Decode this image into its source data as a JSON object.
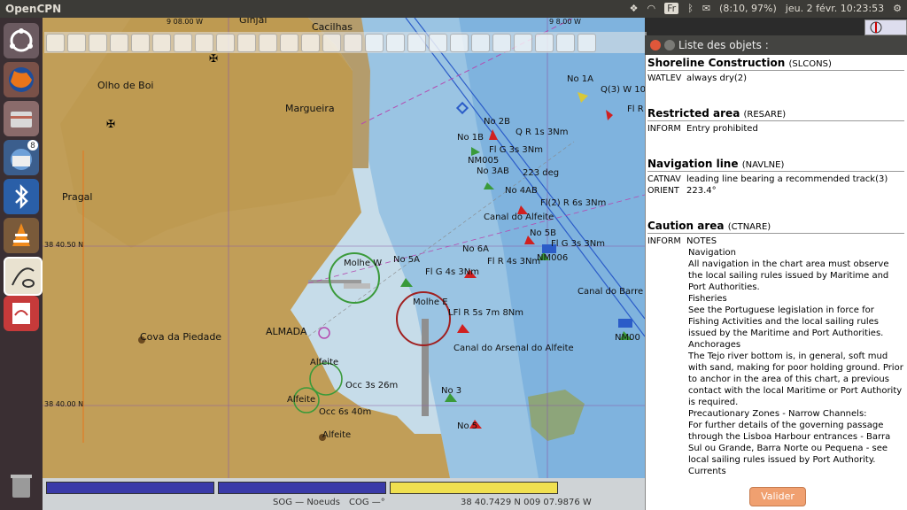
{
  "topbar": {
    "app_name": "OpenCPN",
    "keyboard": "Fr",
    "battery": "(8:10, 97%)",
    "clock": "jeu. 2 févr. 10:23:53"
  },
  "launcher": {
    "items": [
      "ubuntu-icon",
      "firefox-icon",
      "files-icon",
      "thunderbird-icon",
      "bluetooth-icon",
      "vlc-icon",
      "opencpn-icon",
      "evince-icon",
      "trash-icon"
    ],
    "thunderbird_badge": "8"
  },
  "chart": {
    "labels": {
      "ginjal": "Ginjal",
      "cacilhas": "Cacilhas",
      "olho_de_boi": "Olho de Boi",
      "margueira": "Margueira",
      "pragal": "Pragal",
      "cova_da_piedade": "Cova da Piedade",
      "almada": "ALMADA",
      "alfeite1": "Alfeite",
      "alfeite2": "Alfeite",
      "alfeite3": "Alfeite",
      "molhe_w": "Molhe W",
      "molhe_e": "Molhe E",
      "no1a": "No 1A",
      "q3": "Q(3) W 10",
      "no2b": "No 2B",
      "no1b": "No 1B",
      "qr": "Q R 1s 3Nm",
      "fls3": "Fl G 3s 3Nm",
      "nm005": "NM005",
      "no3ab": "No 3AB",
      "deg223": "223 deg",
      "no4ab": "No 4AB",
      "fl2r": "Fl(2) R 6s 3Nm",
      "canal_alfeite": "Canal do Alfeite",
      "no5b": "No 5B",
      "flg3s": "Fl G 3s 3Nm",
      "nm006": "NM006",
      "no5a": "No 5A",
      "no6a": "No 6A",
      "flr4s": "Fl R 4s 3Nm",
      "flg4s": "Fl G 4s 3Nm",
      "canal_barreiro": "Canal do Barre",
      "lflr": "LFl R 5s 7m 8Nm",
      "canal_arsenal": "Canal do Arsenal do Alfeite",
      "occ3s": "Occ 3s 26m",
      "occ6s": "Occ 6s 40m",
      "no3": "No 3",
      "no5": "No 5",
      "nm00": "NM00",
      "flr": "Fl R",
      "lat1": "38 40.50 N",
      "lat2": "38 40.00 N",
      "lon1": "9 08.00 W",
      "lon2": "9 8.00 W"
    }
  },
  "status": {
    "sog": "SOG — Noeuds",
    "cog": "COG —°",
    "position": "38 40.7429 N   009 07.9876 W",
    "bar_colors": [
      "#3a3aa8",
      "#3a3aa8",
      "#f0e050"
    ]
  },
  "panel": {
    "title": "Liste des objets :",
    "objects": [
      {
        "name": "Shoreline Construction",
        "code": "(SLCONS)",
        "attrs": [
          {
            "k": "WATLEV",
            "v": "always dry(2)"
          }
        ]
      },
      {
        "name": "Restricted area",
        "code": "(RESARE)",
        "attrs": [
          {
            "k": "INFORM",
            "v": "Entry prohibited"
          }
        ]
      },
      {
        "name": "Navigation line",
        "code": "(NAVLNE)",
        "attrs": [
          {
            "k": "CATNAV",
            "v": "leading line bearing a recommended track(3)"
          },
          {
            "k": "ORIENT",
            "v": "223.4°"
          }
        ]
      },
      {
        "name": "Caution area",
        "code": "(CTNARE)",
        "attrs": [
          {
            "k": "INFORM",
            "v": "NOTES"
          }
        ]
      }
    ],
    "notes": [
      "Navigation",
      "All navigation in the chart area must observe the local sailing rules issued by Maritime and Port Authorities.",
      "Fisheries",
      "See the Portuguese legislation in force for Fishing Activities and the local sailing rules issued by the Maritime and Port Authorities.",
      "Anchorages",
      "The Tejo river bottom is, in general, soft mud with sand, making for poor holding ground. Prior to anchor in the area of this chart, a previous contact with the local Maritime or Port Authority is required.",
      "Precautionary Zones - Narrow Channels:",
      "For further details of the governing passage through the Lisboa Harbour entrances - Barra Sul ou Grande, Barra Norte ou Pequena - see local sailing rules issued by Port Authority.",
      "Currents"
    ],
    "validate_label": "Valider"
  }
}
